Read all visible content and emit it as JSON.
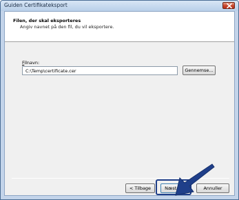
{
  "window": {
    "title": "Guiden Certifikateksport"
  },
  "header": {
    "title": "Filen, der skal eksporteres",
    "subtitle": "Angiv navnet på den fil, du vil eksportere."
  },
  "form": {
    "filename_label_underlined": "F",
    "filename_label_rest": "ilnavn:",
    "filename_value": "C:\\Temp\\certificate.cer",
    "browse_label": "Gennemse..."
  },
  "footer": {
    "back_label": "< Tilbage",
    "next_label": "Næste >",
    "cancel_label": "Annuller"
  },
  "colors": {
    "title_bar": "#c3d4ea",
    "close_button": "#c6432b",
    "highlight": "#1f3f8a"
  },
  "icons": {
    "close": "close-icon",
    "pointer": "arrow-pointer-icon"
  }
}
